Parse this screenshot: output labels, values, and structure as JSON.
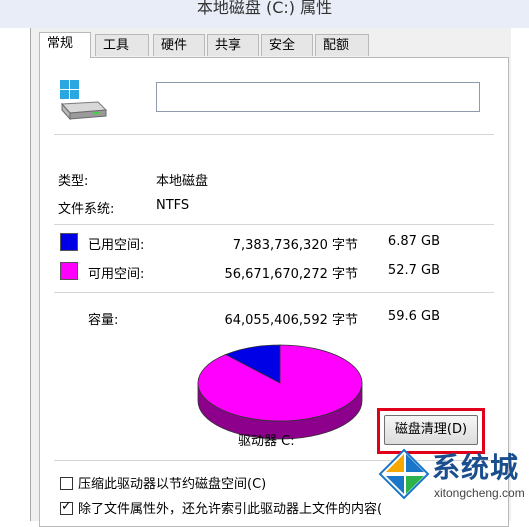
{
  "window": {
    "title": "本地磁盘 (C:) 属性"
  },
  "tabs": [
    {
      "label": "常规",
      "active": true
    },
    {
      "label": "工具",
      "active": false
    },
    {
      "label": "硬件",
      "active": false
    },
    {
      "label": "共享",
      "active": false
    },
    {
      "label": "安全",
      "active": false
    },
    {
      "label": "配额",
      "active": false
    }
  ],
  "general": {
    "name_value": "",
    "type_label": "类型:",
    "type_value": "本地磁盘",
    "fs_label": "文件系统:",
    "fs_value": "NTFS",
    "used": {
      "label": "已用空间:",
      "bytes": "7,383,736,320 字节",
      "size": "6.87 GB",
      "color": "#0000e6"
    },
    "free": {
      "label": "可用空间:",
      "bytes": "56,671,670,272 字节",
      "size": "52.7 GB",
      "color": "#ff00ff"
    },
    "capacity": {
      "label": "容量:",
      "bytes": "64,055,406,592 字节",
      "size": "59.6 GB"
    },
    "drive_label": "驱动器 C:",
    "cleanup_label": "磁盘清理(D)",
    "compress_label": "压缩此驱动器以节约磁盘空间(C)",
    "compress_checked": false,
    "index_label": "除了文件属性外，还允许索引此驱动器上文件的内容(",
    "index_checked": true
  },
  "chart_data": {
    "type": "pie",
    "categories": [
      "已用空间",
      "可用空间"
    ],
    "values": [
      7383736320,
      56671670272
    ],
    "colors": [
      "#0000e6",
      "#ff00ff"
    ]
  },
  "watermark": {
    "text": "系统城",
    "url": "xitongcheng.com"
  }
}
